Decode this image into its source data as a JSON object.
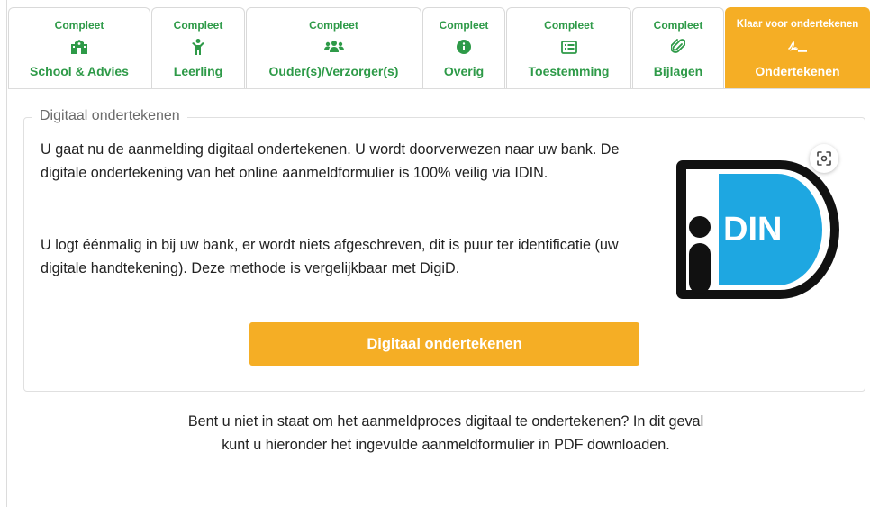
{
  "tabs": [
    {
      "status": "Compleet",
      "label": "School & Advies",
      "icon": "school-icon"
    },
    {
      "status": "Compleet",
      "label": "Leerling",
      "icon": "child-icon"
    },
    {
      "status": "Compleet",
      "label": "Ouder(s)/Verzorger(s)",
      "icon": "users-icon"
    },
    {
      "status": "Compleet",
      "label": "Overig",
      "icon": "info-circle-icon"
    },
    {
      "status": "Compleet",
      "label": "Toestemming",
      "icon": "list-box-icon"
    },
    {
      "status": "Compleet",
      "label": "Bijlagen",
      "icon": "paperclip-icon"
    },
    {
      "status": "Klaar voor ondertekenen",
      "label": "Ondertekenen",
      "icon": "signature-icon"
    }
  ],
  "section": {
    "legend": "Digitaal ondertekenen",
    "paragraph1": "U gaat nu de aanmelding digitaal ondertekenen. U wordt doorverwezen naar uw bank. De digitale ondertekening van het online aanmeldformulier is 100% veilig via IDIN.",
    "paragraph2": "U logt éénmalig in bij uw bank, er wordt niets afgeschreven, dit is puur ter identificatie (uw digitale handtekening). Deze methode is vergelijkbaar met DigiD.",
    "logo_text": "DIN",
    "button_label": "Digitaal ondertekenen"
  },
  "bottom_note": "Bent u niet in staat om het aanmeldproces digitaal te ondertekenen? In dit geval kunt u hieronder het ingevulde aanmeldformulier in PDF downloaden.",
  "colors": {
    "complete_green": "#2e9a48",
    "accent_orange": "#f5ae25",
    "idin_blue": "#1ea7e1"
  }
}
